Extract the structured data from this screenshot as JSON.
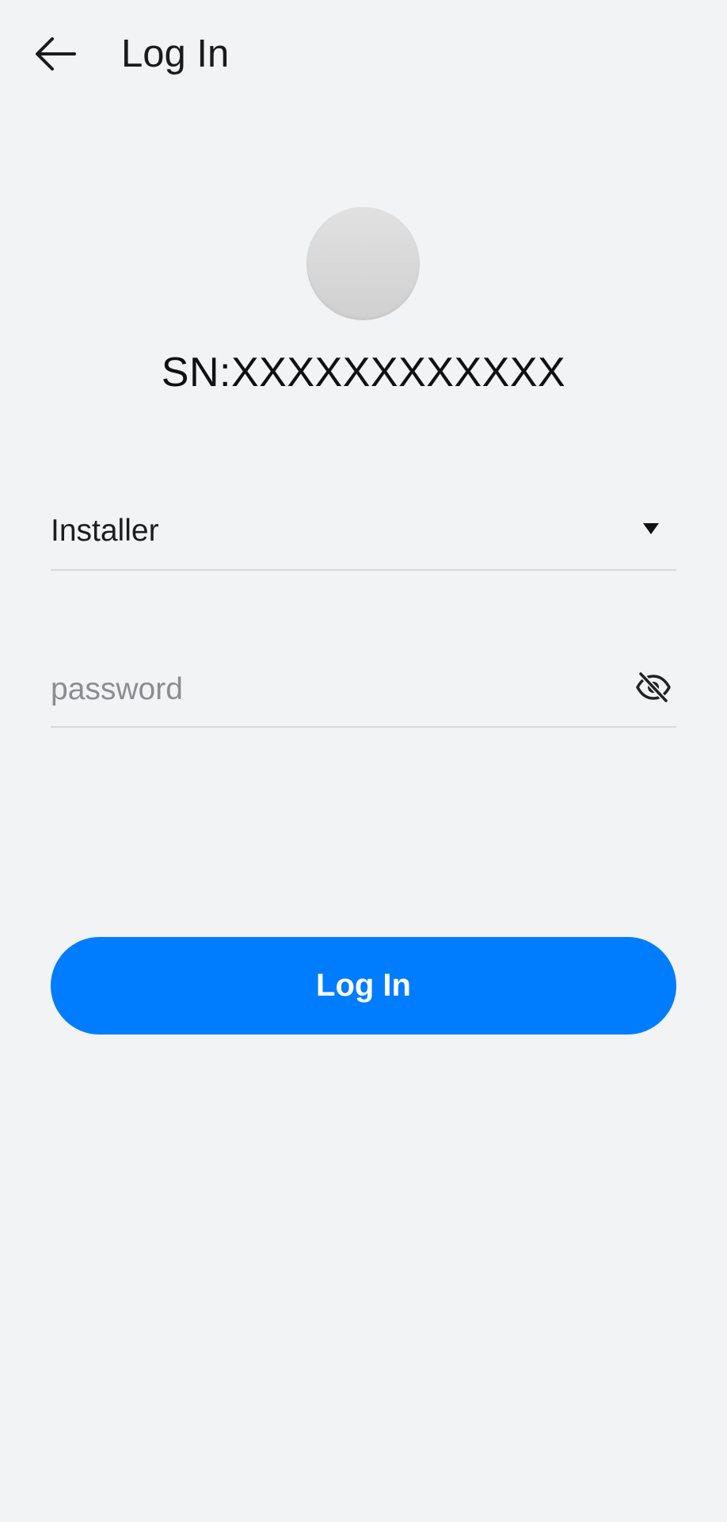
{
  "header": {
    "title": "Log In",
    "back_icon": "arrow-left-icon"
  },
  "device": {
    "serial": "SN:XXXXXXXXXXXX"
  },
  "form": {
    "role": {
      "selected": "Installer",
      "icon": "triangle-down-icon"
    },
    "password": {
      "placeholder": "password",
      "value": "",
      "icon": "eye-off-icon"
    },
    "submit_label": "Log In"
  },
  "colors": {
    "background": "#f1f3f5",
    "primary": "#007cff",
    "divider": "#d6d8db"
  }
}
